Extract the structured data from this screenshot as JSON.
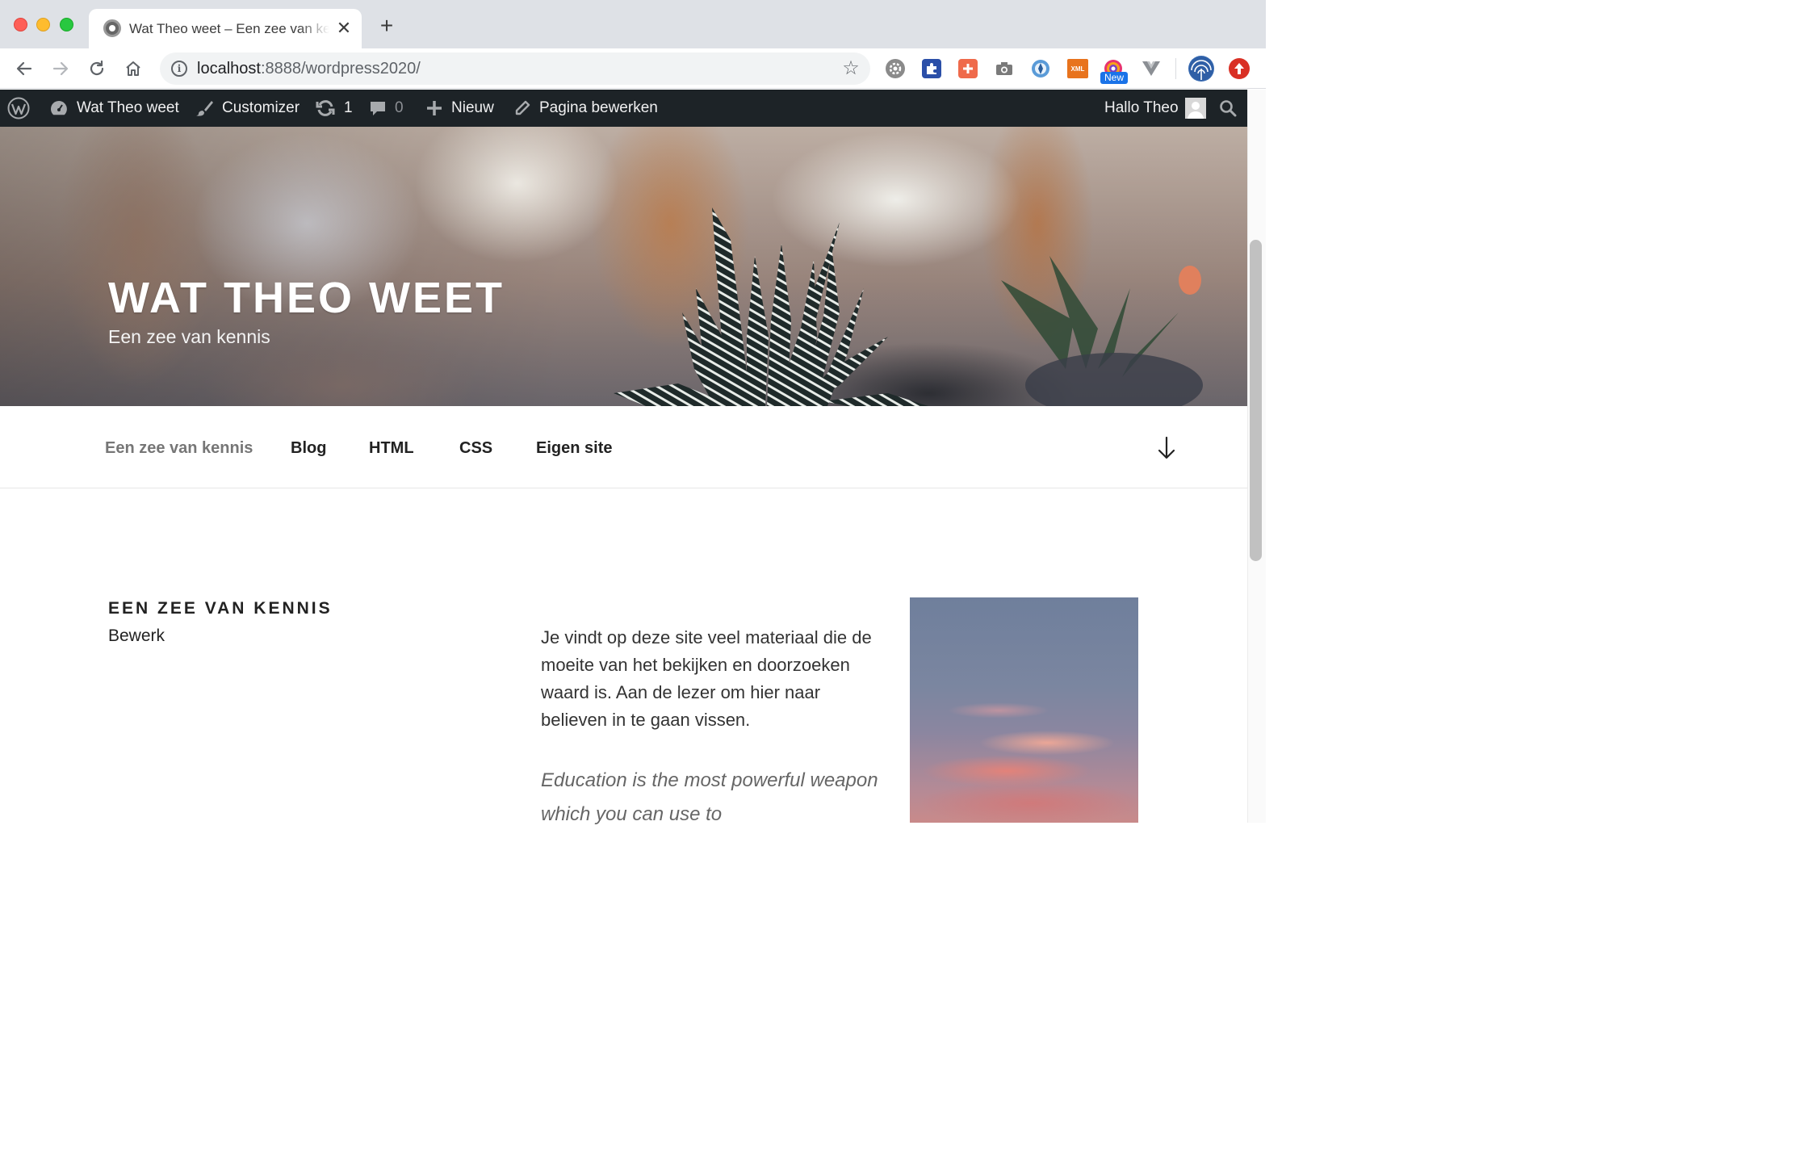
{
  "browser": {
    "tab_title": "Wat Theo weet – Een zee van kennis",
    "tab_close": "✕",
    "new_tab": "+",
    "url_host": "localhost",
    "url_rest": ":8888/wordpress2020/",
    "extensions": [
      "settings-gear-extension",
      "puzzle-extension",
      "plus-extension",
      "camera-extension",
      "compass-extension",
      "xml-extension",
      "rainbow-extension",
      "vue-extension",
      "profile-avatar",
      "update-icon"
    ],
    "ext_xml_label": "XML",
    "ext_new_badge": "New"
  },
  "adminbar": {
    "site_name": "Wat Theo weet",
    "customizer": "Customizer",
    "updates_count": "1",
    "comments_count": "0",
    "new_label": "Nieuw",
    "edit_page": "Pagina bewerken",
    "greeting": "Hallo Theo"
  },
  "header": {
    "site_title": "WAT THEO WEET",
    "tagline": "Een zee van kennis"
  },
  "nav": {
    "items": [
      {
        "label": "Een zee van kennis",
        "current": true
      },
      {
        "label": "Blog",
        "current": false
      },
      {
        "label": "HTML",
        "current": false
      },
      {
        "label": "CSS",
        "current": false
      },
      {
        "label": "Eigen site",
        "current": false
      }
    ]
  },
  "content": {
    "page_title": "EEN ZEE VAN KENNIS",
    "edit_link": "Bewerk",
    "paragraph": "Je vindt op deze site veel materiaal die de moeite van het bekijken en doorzoeken waard is. Aan de lezer om hier naar believen in te gaan vissen.",
    "quote": "Education is the most powerful weapon which you can use to"
  },
  "colors": {
    "adminbar_bg": "#1d2327",
    "tabbar_bg": "#dee1e6",
    "nav_current": "#767676",
    "text": "#222222"
  }
}
